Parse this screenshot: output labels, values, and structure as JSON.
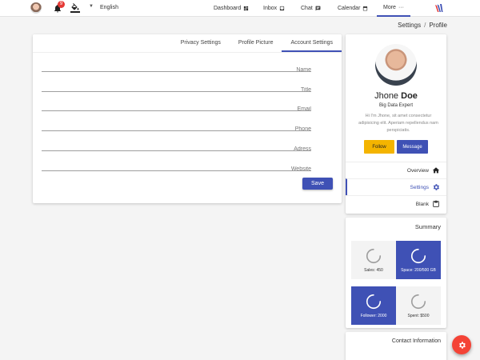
{
  "topbar": {
    "language": "English",
    "notification_count": "9",
    "nav": [
      {
        "label": "Dashboard",
        "icon": "dashboard-icon"
      },
      {
        "label": "Inbox",
        "icon": "inbox-icon"
      },
      {
        "label": "Chat",
        "icon": "chat-icon"
      },
      {
        "label": "Calendar",
        "icon": "calendar-icon"
      },
      {
        "label": "More",
        "icon": "more-icon"
      }
    ]
  },
  "breadcrumb": {
    "parent": "Settings",
    "separator": "/",
    "current": "Profile"
  },
  "tabs": [
    {
      "label": "Privacy Settings",
      "active": false
    },
    {
      "label": "Profile Picture",
      "active": false
    },
    {
      "label": "Account Settings",
      "active": true
    }
  ],
  "form": {
    "fields": [
      {
        "placeholder": "Name",
        "value": ""
      },
      {
        "placeholder": "Title",
        "value": ""
      },
      {
        "placeholder": "Email",
        "value": ""
      },
      {
        "placeholder": "Phone",
        "value": ""
      },
      {
        "placeholder": "Adress",
        "value": ""
      },
      {
        "placeholder": "Website",
        "value": ""
      }
    ],
    "save_label": "Save"
  },
  "profile": {
    "first_name": "Jhone",
    "last_name": "Doe",
    "role": "Big Data Expert",
    "bio": "Hi I'm Jhone, sit amet consectetur adipisicing elit. Aperiam repellendus nam perspiciatis.",
    "follow_label": "Follow",
    "message_label": "Message",
    "menu": [
      {
        "label": "Overview",
        "icon": "home-icon",
        "active": false
      },
      {
        "label": "Settings",
        "icon": "gear-icon",
        "active": true
      },
      {
        "label": "Blank",
        "icon": "clipboard-icon",
        "active": false
      }
    ]
  },
  "summary": {
    "title": "Summary",
    "tiles": [
      {
        "label": "Sales: 450",
        "style": "light"
      },
      {
        "label": "Space: 200/500 GB",
        "style": "blue"
      },
      {
        "label": "Follower: 2000",
        "style": "blue"
      },
      {
        "label": "Spent: $500",
        "style": "light"
      }
    ]
  },
  "contact": {
    "title": "Contact Information"
  },
  "colors": {
    "primary": "#3f51b5",
    "accent": "#f4b400",
    "fab": "#f44336",
    "badge": "#e53935"
  }
}
